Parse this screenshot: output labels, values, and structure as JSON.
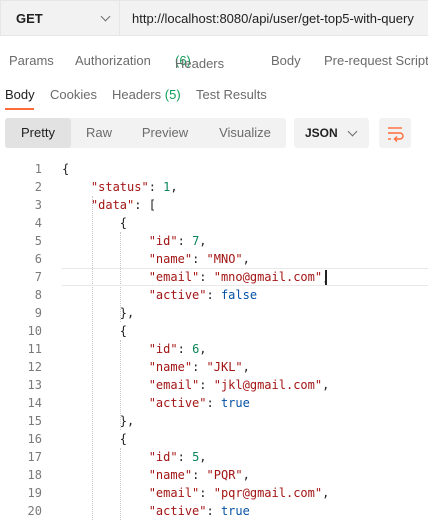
{
  "request": {
    "method": "GET",
    "url": "http://localhost:8080/api/user/get-top5-with-query"
  },
  "request_tabs": {
    "params": "Params",
    "authorization": "Authorization",
    "headers": "Headers",
    "headers_count": "(6)",
    "body": "Body",
    "prerequest": "Pre-request Script"
  },
  "response_tabs": {
    "body": "Body",
    "cookies": "Cookies",
    "headers": "Headers",
    "headers_count": "(5)",
    "test_results": "Test Results"
  },
  "view_modes": {
    "pretty": "Pretty",
    "raw": "Raw",
    "preview": "Preview",
    "visualize": "Visualize"
  },
  "format": "JSON",
  "colors": {
    "accent": "#ff6c37",
    "count": "#0f9d58",
    "json_key": "#a31515",
    "json_number": "#098658",
    "json_keyword": "#0451a5"
  },
  "code_lines": [
    {
      "n": "1",
      "text": "{"
    },
    {
      "n": "2",
      "text": "    \"status\": 1,"
    },
    {
      "n": "3",
      "text": "    \"data\": ["
    },
    {
      "n": "4",
      "text": "        {"
    },
    {
      "n": "5",
      "text": "            \"id\": 7,"
    },
    {
      "n": "6",
      "text": "            \"name\": \"MNO\","
    },
    {
      "n": "7",
      "text": "            \"email\": \"mno@gmail.com\","
    },
    {
      "n": "8",
      "text": "            \"active\": false"
    },
    {
      "n": "9",
      "text": "        },"
    },
    {
      "n": "10",
      "text": "        {"
    },
    {
      "n": "11",
      "text": "            \"id\": 6,"
    },
    {
      "n": "12",
      "text": "            \"name\": \"JKL\","
    },
    {
      "n": "13",
      "text": "            \"email\": \"jkl@gmail.com\","
    },
    {
      "n": "14",
      "text": "            \"active\": true"
    },
    {
      "n": "15",
      "text": "        },"
    },
    {
      "n": "16",
      "text": "        {"
    },
    {
      "n": "17",
      "text": "            \"id\": 5,"
    },
    {
      "n": "18",
      "text": "            \"name\": \"PQR\","
    },
    {
      "n": "19",
      "text": "            \"email\": \"pqr@gmail.com\","
    },
    {
      "n": "20",
      "text": "            \"active\": true"
    }
  ]
}
